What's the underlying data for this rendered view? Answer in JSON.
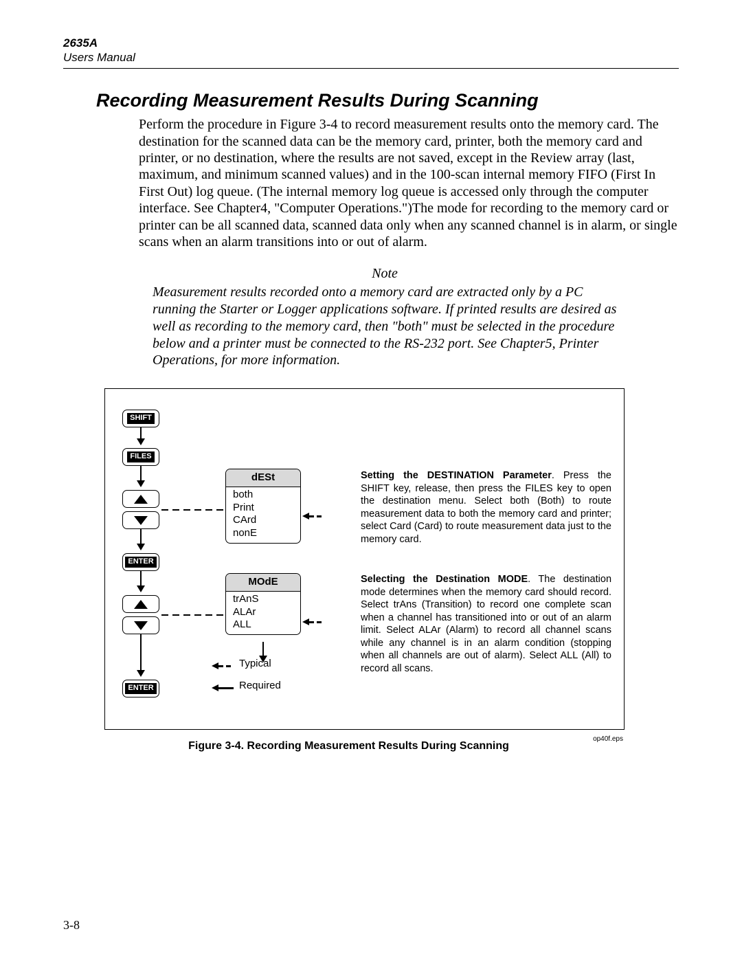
{
  "header": {
    "model": "2635A",
    "doc": "Users Manual"
  },
  "section_title": "Recording Measurement Results During Scanning",
  "body_para": "Perform the procedure in Figure 3-4 to record measurement results onto the memory card. The destination for the scanned data can be the memory card, printer, both the memory card and printer, or no destination, where the results are not saved, except in the Review array (last, maximum, and minimum scanned values) and in the 100-scan internal memory FIFO (First In First Out) log queue. (The internal memory log queue is accessed only through the computer interface. See Chapter4, \"Computer Operations.\")The mode for recording to the memory card or printer can be all scanned data, scanned data only when any scanned channel is in alarm, or single scans when an alarm transitions into or out of alarm.",
  "note_label": "Note",
  "note_body": "Measurement results recorded onto a memory card are extracted only by a PC running the Starter or Logger applications software. If printed results are desired as well as recording to the memory card, then \"both\" must be selected in the procedure below and a printer must be connected to the RS-232 port. See Chapter5, Printer Operations, for more information.",
  "figure": {
    "buttons": {
      "shift": "SHIFT",
      "files": "FILES",
      "enter": "ENTER"
    },
    "dest": {
      "head": "dESt",
      "opt1": "both",
      "opt2": "Print",
      "opt3": "CArd",
      "opt4": "nonE"
    },
    "mode": {
      "head": "MOdE",
      "opt1": "trAnS",
      "opt2": "ALAr",
      "opt3": "ALL"
    },
    "legend_typical": "Typical",
    "legend_required": "Required",
    "expl1_bold": "Setting the DESTINATION Parameter",
    "expl1_rest": ".   Press the SHIFT key, release, then press the FILES key to open the destination menu.  Select both (Both) to route measurement data to both the memory card and printer; select Card (Card)  to route measurement data just to the memory card.",
    "expl2_bold": "Selecting  the  Destination  MODE",
    "expl2_rest": ".     The destination mode determines when the memory card should record.  Select trAns (Transition) to record one complete scan when a channel has transitioned into or out of an alarm limit.  Select ALAr (Alarm) to record all channel scans while any channel is in an alarm condition (stopping when all channels are out of alarm).  Select ALL (All) to record all scans."
  },
  "figure_caption": "Figure 3-4. Recording Measurement Results During Scanning",
  "figure_eps": "op40f.eps",
  "page_number": "3-8"
}
